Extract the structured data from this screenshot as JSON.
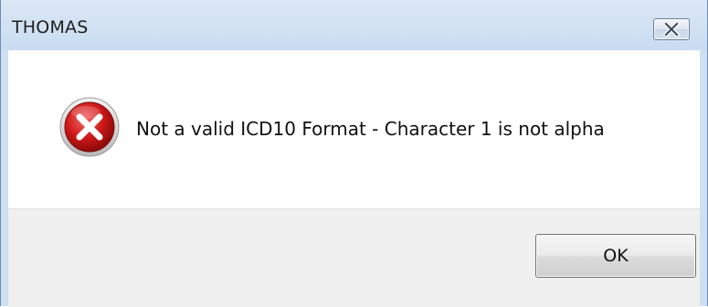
{
  "window": {
    "title": "THOMAS"
  },
  "dialog": {
    "icon": "error-icon",
    "message": "Not a valid ICD10 Format - Character 1 is not alpha",
    "ok_label": "OK"
  },
  "colors": {
    "error_red": "#d11a1a",
    "titlebar": "#d2e2f3",
    "button_area": "#f0f0f0"
  }
}
